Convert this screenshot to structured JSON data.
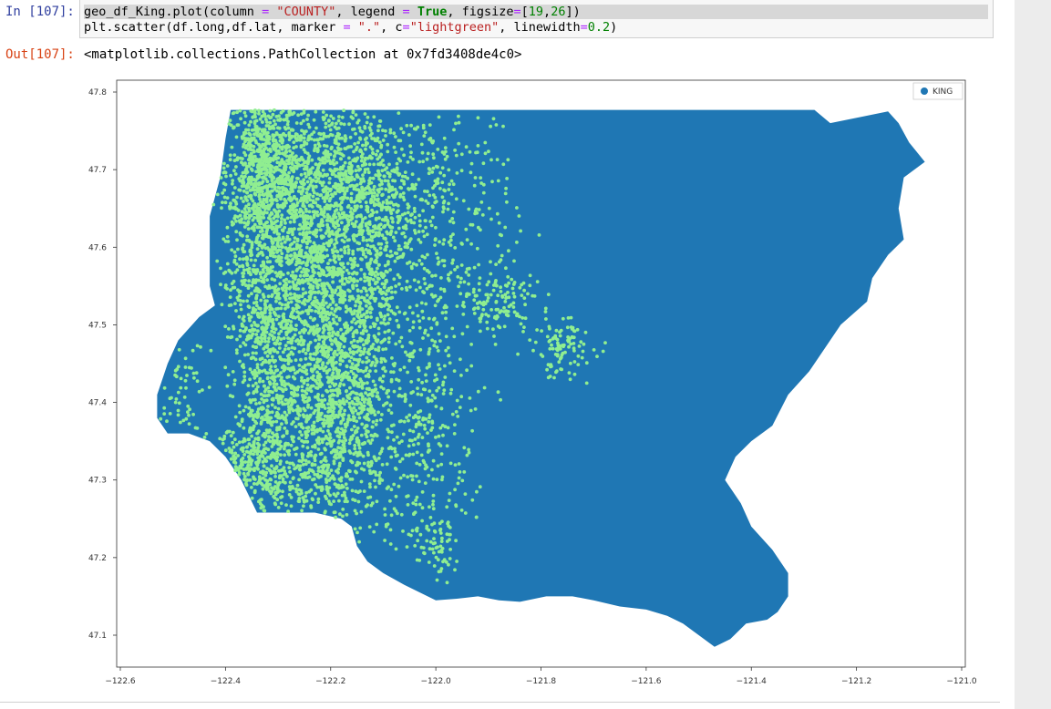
{
  "cell": {
    "in_prompt": "In [107]:",
    "out_prompt": "Out[107]:",
    "code_line1": [
      {
        "t": "geo_df_King.plot(column ",
        "c": ""
      },
      {
        "t": "=",
        "c": "op"
      },
      {
        "t": " ",
        "c": ""
      },
      {
        "t": "\"COUNTY\"",
        "c": "str"
      },
      {
        "t": ", legend ",
        "c": ""
      },
      {
        "t": "=",
        "c": "op"
      },
      {
        "t": " ",
        "c": ""
      },
      {
        "t": "True",
        "c": "kw"
      },
      {
        "t": ", figsize",
        "c": ""
      },
      {
        "t": "=",
        "c": "op"
      },
      {
        "t": "[",
        "c": ""
      },
      {
        "t": "19",
        "c": "num"
      },
      {
        "t": ",",
        "c": ""
      },
      {
        "t": "26",
        "c": "num"
      },
      {
        "t": "])",
        "c": ""
      }
    ],
    "code_line2": [
      {
        "t": "plt.scatter(df.long,df.lat, marker ",
        "c": ""
      },
      {
        "t": "=",
        "c": "op"
      },
      {
        "t": " ",
        "c": ""
      },
      {
        "t": "\".\"",
        "c": "str"
      },
      {
        "t": ", c",
        "c": ""
      },
      {
        "t": "=",
        "c": "op"
      },
      {
        "t": "\"lightgreen\"",
        "c": "str"
      },
      {
        "t": ", linewidth",
        "c": ""
      },
      {
        "t": "=",
        "c": "op"
      },
      {
        "t": "0.2",
        "c": "num"
      },
      {
        "t": ")",
        "c": ""
      }
    ],
    "output_text": "<matplotlib.collections.PathCollection at 0x7fd3408de4c0>"
  },
  "chart_data": {
    "type": "scatter",
    "legend": {
      "labels": [
        "KING"
      ],
      "placement": "top-right"
    },
    "x_ticks": [
      "−122.6",
      "−122.4",
      "−122.2",
      "−122.0",
      "−121.8",
      "−121.6",
      "−121.4",
      "−121.2",
      "−121.0"
    ],
    "y_ticks": [
      "47.8",
      "47.7",
      "47.6",
      "47.5",
      "47.4",
      "47.3",
      "47.2",
      "47.1"
    ],
    "xlim": [
      -122.6,
      -121.0
    ],
    "ylim": [
      47.06,
      47.81
    ],
    "colors": {
      "county_fill": "#1f77b4",
      "points": "#90ee90"
    },
    "county_outline": [
      [
        -122.39,
        47.777
      ],
      [
        -121.88,
        47.777
      ],
      [
        -121.74,
        47.777
      ],
      [
        -121.28,
        47.777
      ],
      [
        -121.25,
        47.76
      ],
      [
        -121.14,
        47.775
      ],
      [
        -121.12,
        47.76
      ],
      [
        -121.1,
        47.735
      ],
      [
        -121.07,
        47.71
      ],
      [
        -121.11,
        47.69
      ],
      [
        -121.12,
        47.65
      ],
      [
        -121.11,
        47.61
      ],
      [
        -121.14,
        47.59
      ],
      [
        -121.17,
        47.56
      ],
      [
        -121.18,
        47.53
      ],
      [
        -121.23,
        47.5
      ],
      [
        -121.26,
        47.47
      ],
      [
        -121.29,
        47.44
      ],
      [
        -121.33,
        47.41
      ],
      [
        -121.36,
        47.37
      ],
      [
        -121.4,
        47.35
      ],
      [
        -121.43,
        47.33
      ],
      [
        -121.45,
        47.3
      ],
      [
        -121.42,
        47.27
      ],
      [
        -121.4,
        47.24
      ],
      [
        -121.36,
        47.21
      ],
      [
        -121.33,
        47.18
      ],
      [
        -121.33,
        47.15
      ],
      [
        -121.35,
        47.13
      ],
      [
        -121.37,
        47.12
      ],
      [
        -121.41,
        47.115
      ],
      [
        -121.44,
        47.095
      ],
      [
        -121.47,
        47.085
      ],
      [
        -121.5,
        47.1
      ],
      [
        -121.53,
        47.115
      ],
      [
        -121.56,
        47.125
      ],
      [
        -121.6,
        47.133
      ],
      [
        -121.65,
        47.137
      ],
      [
        -121.7,
        47.145
      ],
      [
        -121.74,
        47.15
      ],
      [
        -121.79,
        47.15
      ],
      [
        -121.84,
        47.143
      ],
      [
        -121.88,
        47.145
      ],
      [
        -121.92,
        47.15
      ],
      [
        -121.96,
        47.147
      ],
      [
        -122.0,
        47.145
      ],
      [
        -122.03,
        47.155
      ],
      [
        -122.06,
        47.165
      ],
      [
        -122.1,
        47.18
      ],
      [
        -122.13,
        47.195
      ],
      [
        -122.15,
        47.215
      ],
      [
        -122.16,
        47.24
      ],
      [
        -122.18,
        47.25
      ],
      [
        -122.23,
        47.258
      ],
      [
        -122.29,
        47.258
      ],
      [
        -122.34,
        47.258
      ],
      [
        -122.37,
        47.3
      ],
      [
        -122.4,
        47.33
      ],
      [
        -122.43,
        47.35
      ],
      [
        -122.47,
        47.36
      ],
      [
        -122.51,
        47.36
      ],
      [
        -122.53,
        47.38
      ],
      [
        -122.53,
        47.41
      ],
      [
        -122.51,
        47.45
      ],
      [
        -122.49,
        47.48
      ],
      [
        -122.45,
        47.51
      ],
      [
        -122.42,
        47.525
      ],
      [
        -122.43,
        47.55
      ],
      [
        -122.43,
        47.6
      ],
      [
        -122.43,
        47.64
      ],
      [
        -122.41,
        47.69
      ],
      [
        -122.4,
        47.74
      ],
      [
        -122.39,
        47.777
      ]
    ],
    "point_clusters": [
      {
        "cx": -122.33,
        "cy": 47.7,
        "sx": 0.035,
        "sy": 0.05,
        "n": 700
      },
      {
        "cx": -122.26,
        "cy": 47.68,
        "sx": 0.04,
        "sy": 0.06,
        "n": 500
      },
      {
        "cx": -122.18,
        "cy": 47.69,
        "sx": 0.04,
        "sy": 0.05,
        "n": 400
      },
      {
        "cx": -122.11,
        "cy": 47.66,
        "sx": 0.04,
        "sy": 0.06,
        "n": 350
      },
      {
        "cx": -122.33,
        "cy": 47.56,
        "sx": 0.035,
        "sy": 0.07,
        "n": 600
      },
      {
        "cx": -122.23,
        "cy": 47.56,
        "sx": 0.03,
        "sy": 0.06,
        "n": 450
      },
      {
        "cx": -122.14,
        "cy": 47.55,
        "sx": 0.04,
        "sy": 0.06,
        "n": 400
      },
      {
        "cx": -122.3,
        "cy": 47.4,
        "sx": 0.04,
        "sy": 0.07,
        "n": 600
      },
      {
        "cx": -122.2,
        "cy": 47.43,
        "sx": 0.04,
        "sy": 0.06,
        "n": 500
      },
      {
        "cx": -122.13,
        "cy": 47.4,
        "sx": 0.03,
        "sy": 0.05,
        "n": 250
      },
      {
        "cx": -122.35,
        "cy": 47.31,
        "sx": 0.04,
        "sy": 0.03,
        "n": 300
      },
      {
        "cx": -122.2,
        "cy": 47.33,
        "sx": 0.04,
        "sy": 0.04,
        "n": 250
      },
      {
        "cx": -122.04,
        "cy": 47.52,
        "sx": 0.06,
        "sy": 0.1,
        "n": 250
      },
      {
        "cx": -121.99,
        "cy": 47.7,
        "sx": 0.05,
        "sy": 0.05,
        "n": 150
      },
      {
        "cx": -122.02,
        "cy": 47.36,
        "sx": 0.05,
        "sy": 0.06,
        "n": 150
      },
      {
        "cx": -121.88,
        "cy": 47.53,
        "sx": 0.04,
        "sy": 0.02,
        "n": 120
      },
      {
        "cx": -121.76,
        "cy": 47.47,
        "sx": 0.03,
        "sy": 0.02,
        "n": 100
      },
      {
        "cx": -122.0,
        "cy": 47.21,
        "sx": 0.02,
        "sy": 0.02,
        "n": 60
      },
      {
        "cx": -122.48,
        "cy": 47.42,
        "sx": 0.02,
        "sy": 0.04,
        "n": 60
      },
      {
        "cx": -122.1,
        "cy": 47.27,
        "sx": 0.08,
        "sy": 0.03,
        "n": 120
      },
      {
        "cx": -121.95,
        "cy": 47.62,
        "sx": 0.06,
        "sy": 0.06,
        "n": 100
      }
    ]
  }
}
